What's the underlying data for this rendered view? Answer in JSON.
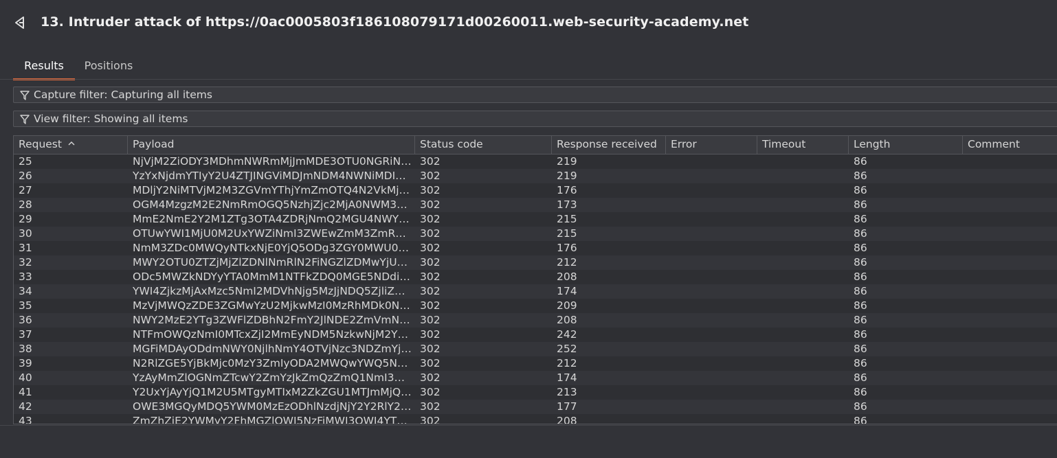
{
  "window": {
    "title": "13. Intruder attack of https://0ac0005803f186108079171d00260011.web-security-academy.net"
  },
  "tabs": [
    {
      "label": "Results",
      "active": true
    },
    {
      "label": "Positions",
      "active": false
    }
  ],
  "filters": {
    "capture": "Capture filter: Capturing all items",
    "view": "View filter: Showing all items"
  },
  "colors": {
    "accent": "#e06a3c",
    "background": "#323338",
    "text": "#d6d6d6"
  },
  "table": {
    "columns": [
      {
        "label": "Request",
        "sorted": "ascending"
      },
      {
        "label": "Payload"
      },
      {
        "label": "Status code"
      },
      {
        "label": "Response received"
      },
      {
        "label": "Error"
      },
      {
        "label": "Timeout"
      },
      {
        "label": "Length"
      },
      {
        "label": "Comment"
      }
    ],
    "rows": [
      {
        "request": "25",
        "payload": "NjVjM2ZiODY3MDhmNWRmMjJmMDE3OTU0NGRiN…",
        "status": "302",
        "response": "219",
        "error": "",
        "timeout": "",
        "length": "86",
        "comment": ""
      },
      {
        "request": "26",
        "payload": "YzYxNjdmYTIyY2U4ZTJINGViMDJmNDM4NWNiMDIm…",
        "status": "302",
        "response": "219",
        "error": "",
        "timeout": "",
        "length": "86",
        "comment": ""
      },
      {
        "request": "27",
        "payload": "MDljY2NiMTVjM2M3ZGVmYThjYmZmOTQ4N2VkMjVi…",
        "status": "302",
        "response": "176",
        "error": "",
        "timeout": "",
        "length": "86",
        "comment": ""
      },
      {
        "request": "28",
        "payload": "OGM4MzgzM2E2NmRmOGQ5NzhjZjc2MjA0NWM3…",
        "status": "302",
        "response": "173",
        "error": "",
        "timeout": "",
        "length": "86",
        "comment": ""
      },
      {
        "request": "29",
        "payload": "MmE2NmE2Y2M1ZTg3OTA4ZDRjNmQ2MGU4NWY…",
        "status": "302",
        "response": "215",
        "error": "",
        "timeout": "",
        "length": "86",
        "comment": ""
      },
      {
        "request": "30",
        "payload": "OTUwYWI1MjU0M2UxYWZiNmI3ZWEwZmM3ZmR…",
        "status": "302",
        "response": "215",
        "error": "",
        "timeout": "",
        "length": "86",
        "comment": ""
      },
      {
        "request": "31",
        "payload": "NmM3ZDc0MWQyNTkxNjE0YjQ5ODg3ZGY0MWU0…",
        "status": "302",
        "response": "176",
        "error": "",
        "timeout": "",
        "length": "86",
        "comment": ""
      },
      {
        "request": "32",
        "payload": "MWY2OTU0ZTZjMjZlZDNlNmRlN2FiNGZlZDMwYjU…",
        "status": "302",
        "response": "212",
        "error": "",
        "timeout": "",
        "length": "86",
        "comment": ""
      },
      {
        "request": "33",
        "payload": "ODc5MWZkNDYyYTA0MmM1NTFkZDQ0MGE5NDdi…",
        "status": "302",
        "response": "208",
        "error": "",
        "timeout": "",
        "length": "86",
        "comment": ""
      },
      {
        "request": "34",
        "payload": "YWI4ZjkzMjAxMzc5NmI2MDVhNjg5MzJjNDQ5ZjliZ…",
        "status": "302",
        "response": "174",
        "error": "",
        "timeout": "",
        "length": "86",
        "comment": ""
      },
      {
        "request": "35",
        "payload": "MzVjMWQzZDE3ZGMwYzU2MjkwMzI0MzRhMDk0N…",
        "status": "302",
        "response": "209",
        "error": "",
        "timeout": "",
        "length": "86",
        "comment": ""
      },
      {
        "request": "36",
        "payload": "NWY2MzE2YTg3ZWFlZDBhN2FmY2JlNDE2ZmVmN…",
        "status": "302",
        "response": "208",
        "error": "",
        "timeout": "",
        "length": "86",
        "comment": ""
      },
      {
        "request": "37",
        "payload": "NTFmOWQzNmI0MTcxZjI2MmEyNDM5NzkwNjM2Y…",
        "status": "302",
        "response": "242",
        "error": "",
        "timeout": "",
        "length": "86",
        "comment": ""
      },
      {
        "request": "38",
        "payload": "MGFiMDAyODdmNWY0NjlhNmY4OTVjNzc3NDZmYj…",
        "status": "302",
        "response": "252",
        "error": "",
        "timeout": "",
        "length": "86",
        "comment": ""
      },
      {
        "request": "39",
        "payload": "N2RlZGE5YjBkMjc0MzY3ZmIyODA2MWQwYWQ5N…",
        "status": "302",
        "response": "212",
        "error": "",
        "timeout": "",
        "length": "86",
        "comment": ""
      },
      {
        "request": "40",
        "payload": "YzAyMmZlOGNmZTcwY2ZmYzJkZmQzZmQ1NmI3…",
        "status": "302",
        "response": "174",
        "error": "",
        "timeout": "",
        "length": "86",
        "comment": ""
      },
      {
        "request": "41",
        "payload": "Y2UxYjAyYjQ1M2U5MTgyMTIxM2ZkZGU1MTJmMjQ…",
        "status": "302",
        "response": "213",
        "error": "",
        "timeout": "",
        "length": "86",
        "comment": ""
      },
      {
        "request": "42",
        "payload": "OWE3MGQyMDQ5YWM0MzEzODhlNzdjNjY2Y2RlY2…",
        "status": "302",
        "response": "177",
        "error": "",
        "timeout": "",
        "length": "86",
        "comment": ""
      },
      {
        "request": "43",
        "payload": "ZmZhZjE2YWMyY2FhMGZlOWI5NzFiMWI3OWI4YT…",
        "status": "302",
        "response": "208",
        "error": "",
        "timeout": "",
        "length": "86",
        "comment": ""
      }
    ]
  }
}
